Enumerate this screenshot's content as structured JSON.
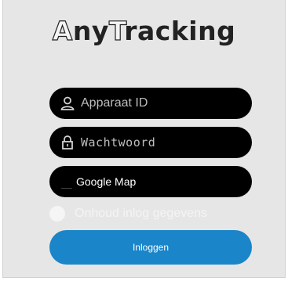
{
  "app": {
    "logo_a": "A",
    "logo_mid": "ny",
    "logo_t": "T",
    "logo_rest": "racking"
  },
  "login": {
    "device_id_placeholder": "Apparaat ID",
    "password_placeholder": "Wachtwoord",
    "map_selected": "Google Map",
    "remember_label": "Onhoud inlog gegevens",
    "submit_label": "Inloggen"
  },
  "icons": {
    "device_id": "user-icon",
    "password": "lock-icon"
  },
  "colors": {
    "background": "#e6e6e6",
    "field": "#000000",
    "button": "#1a85c9"
  }
}
